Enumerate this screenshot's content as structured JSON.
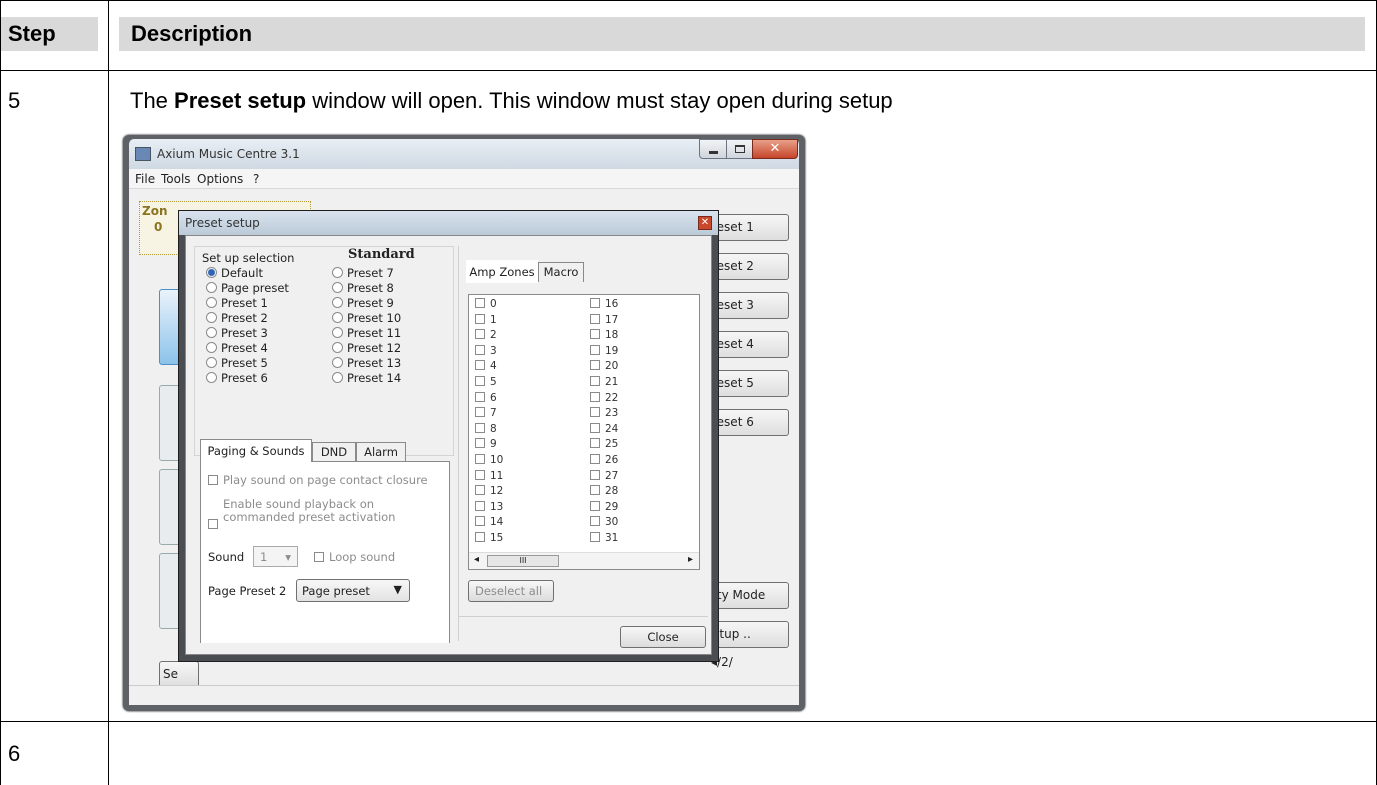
{
  "table": {
    "header_step": "Step",
    "header_description": "Description",
    "row5_step": "5",
    "row5_text_prefix": "The ",
    "row5_text_bold": "Preset setup",
    "row5_text_suffix": " window will open. This window must stay open during setup",
    "row6_step": "6"
  },
  "app": {
    "title": "Axium Music Centre 3.1",
    "menu": [
      "File",
      "Tools",
      "Options",
      "?"
    ],
    "zone_label": "Zon",
    "zone_value": "0",
    "right_buttons": [
      "reset 1",
      "reset 2",
      "reset 3",
      "reset 4",
      "reset 5",
      "reset 6"
    ],
    "party_mode": "rty Mode",
    "setup_button": "etup ..",
    "bottom_left_button": "Se",
    "page_indicator": "2"
  },
  "dialog": {
    "title": "Preset setup",
    "setup_selection_label": "Set up selection",
    "standard_label": "Standard",
    "radios_left": [
      "Default",
      "Page preset",
      "Preset 1",
      "Preset 2",
      "Preset 3",
      "Preset 4",
      "Preset 5",
      "Preset 6"
    ],
    "radios_right": [
      "Preset 7",
      "Preset 8",
      "Preset 9",
      "Preset 10",
      "Preset 11",
      "Preset 12",
      "Preset 13",
      "Preset 14"
    ],
    "tabs_bottom": [
      "Paging & Sounds",
      "DND",
      "Alarm"
    ],
    "play_sound_label": "Play sound on page contact closure",
    "enable_sound_label_1": "Enable sound playback on",
    "enable_sound_label_2": "commanded preset activation",
    "sound_label": "Sound",
    "sound_value": "1",
    "loop_sound_label": "Loop sound",
    "page_preset_label": "Page Preset 2",
    "page_preset_value": "Page preset",
    "tabs_right": [
      "Amp Zones",
      "Macro"
    ],
    "zones_col1": [
      "0",
      "1",
      "2",
      "3",
      "4",
      "5",
      "6",
      "7",
      "8",
      "9",
      "10",
      "11",
      "12",
      "13",
      "14",
      "15"
    ],
    "zones_col2": [
      "16",
      "17",
      "18",
      "19",
      "20",
      "21",
      "22",
      "23",
      "24",
      "25",
      "26",
      "27",
      "28",
      "29",
      "30",
      "31"
    ],
    "deselect_all": "Deselect all",
    "close_button": "Close"
  }
}
